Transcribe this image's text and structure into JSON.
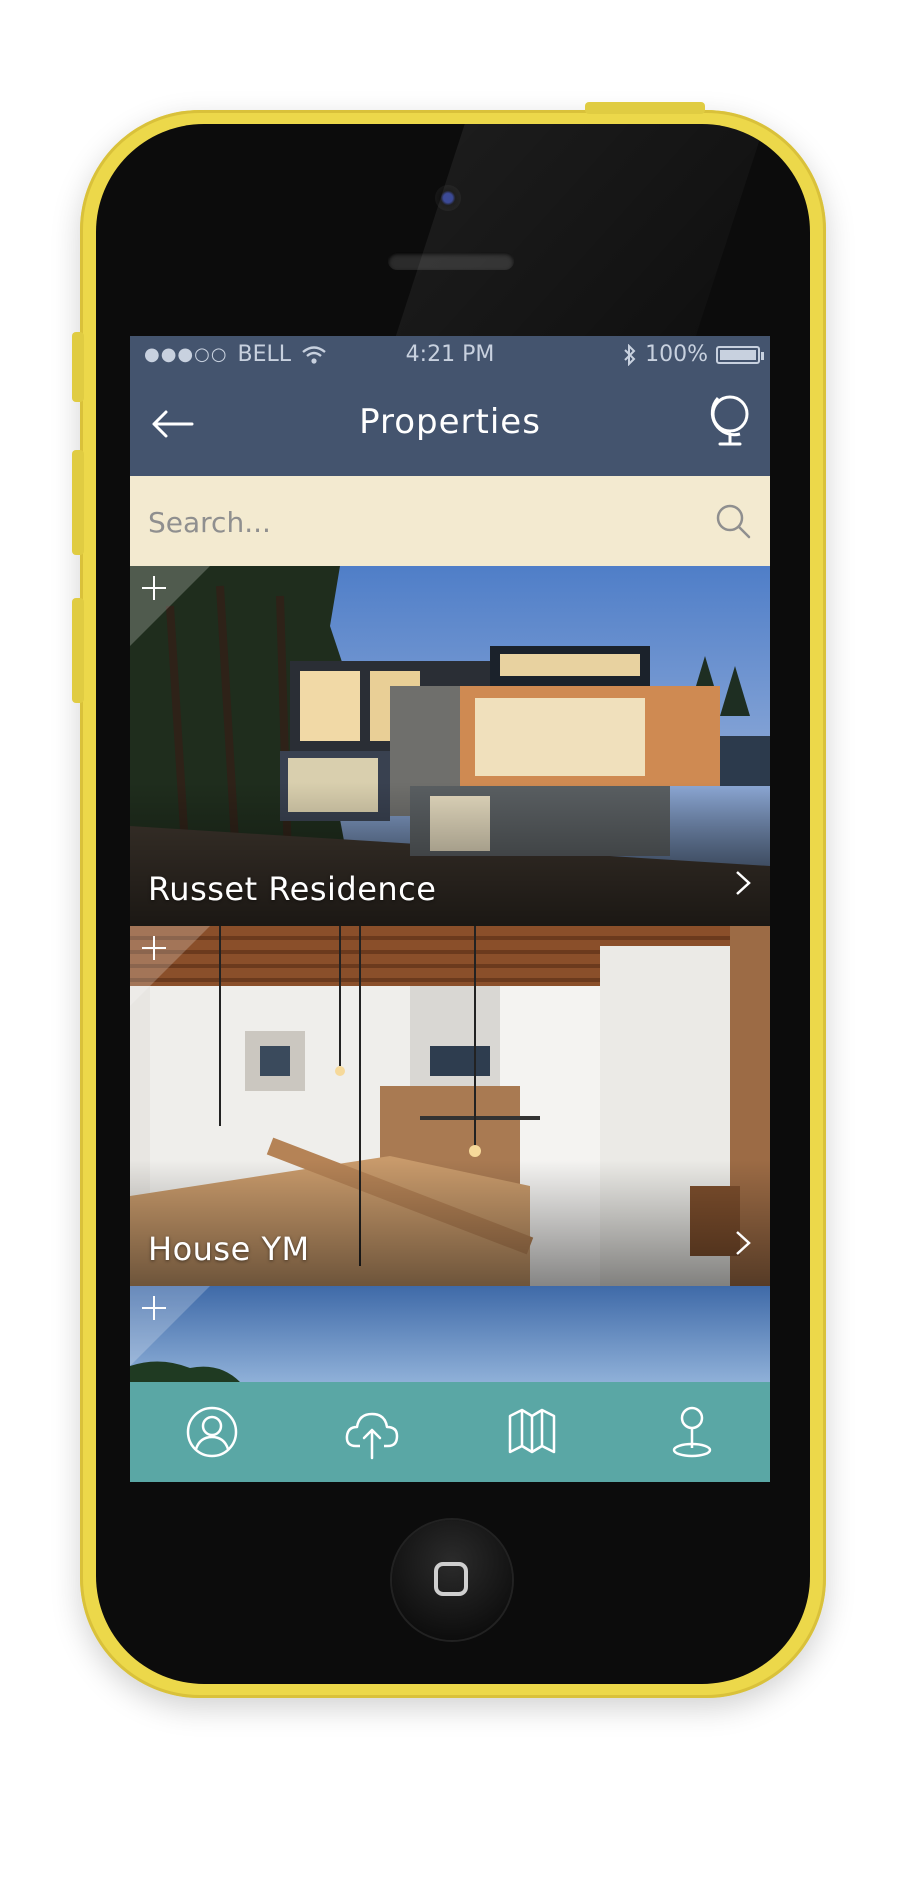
{
  "status_bar": {
    "signal": "●●●○○",
    "carrier": "BELL",
    "time": "4:21 PM",
    "battery": "100%"
  },
  "nav": {
    "title": "Properties",
    "back_icon": "back-arrow-icon",
    "right_icon": "globe-icon"
  },
  "search": {
    "placeholder": "Search...",
    "icon": "search-icon"
  },
  "properties": [
    {
      "name": "Russet Residence"
    },
    {
      "name": "House YM"
    },
    {
      "name": ""
    }
  ],
  "tab_bar": {
    "items": [
      {
        "icon": "profile-icon"
      },
      {
        "icon": "upload-cloud-icon"
      },
      {
        "icon": "map-icon"
      },
      {
        "icon": "location-pin-icon"
      }
    ]
  },
  "colors": {
    "phone_shell": "#ecd84a",
    "nav_background": "#44546e",
    "search_background": "#f3ead0",
    "tab_bar_background": "#5aa7a5"
  }
}
